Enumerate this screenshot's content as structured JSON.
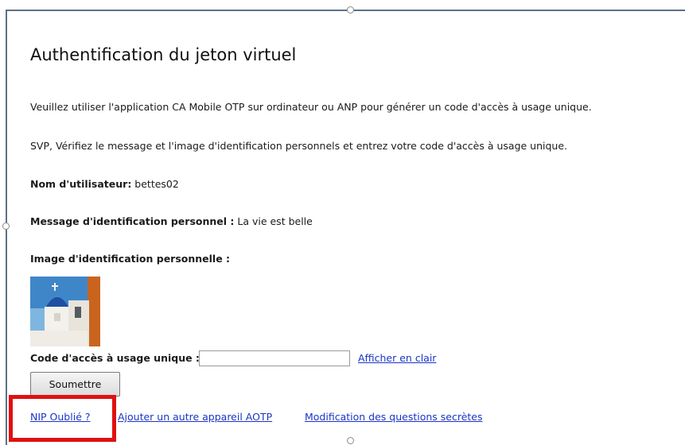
{
  "page": {
    "title": "Authentification du jeton virtuel",
    "instruction_1": "Veuillez utiliser l'application CA Mobile OTP sur ordinateur ou ANP pour générer un code d'accès à usage unique.",
    "instruction_2": "SVP, Vérifiez le message et l'image d'identification personnels et entrez votre code d'accès à usage unique."
  },
  "fields": {
    "username_label": "Nom d'utilisateur:",
    "username_value": " bettes02",
    "message_label": "Message d'identification personnel :",
    "message_value": " La vie est belle",
    "image_label": "Image d'identification personnelle :",
    "otp_label": "Code d'accès à usage unique :",
    "otp_value": "",
    "show_clear_link": "Afficher en clair"
  },
  "image": {
    "icon": "santorini-church-photo",
    "sky_color": "#3f86c9",
    "wall_color": "#f3f1ec",
    "dome_color": "#1f4fa0"
  },
  "actions": {
    "submit_label": "Soumettre",
    "forgot_pin": "NIP Oublié ?",
    "add_device": "Ajouter un autre appareil AOTP",
    "modify_questions": "Modification des questions secrètes"
  },
  "highlight": {
    "color": "#e01010"
  }
}
